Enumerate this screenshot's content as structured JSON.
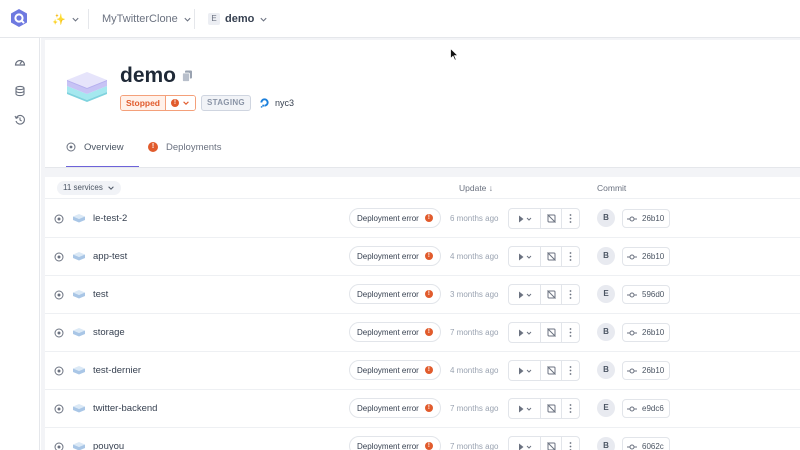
{
  "topbar": {
    "organization_icon": "sparkle-emoji",
    "project": "MyTwitterClone",
    "environment_badge": "E",
    "environment": "demo"
  },
  "sidebar": {
    "items": [
      {
        "icon": "gauge-icon"
      },
      {
        "icon": "database-icon"
      },
      {
        "icon": "history-icon"
      }
    ]
  },
  "header": {
    "title": "demo",
    "status": "Stopped",
    "mode": "STAGING",
    "region": "nyc3"
  },
  "tabs": [
    {
      "label": "Overview",
      "icon": "overview-icon",
      "active": true
    },
    {
      "label": "Deployments",
      "icon": "error-icon",
      "active": false
    }
  ],
  "table": {
    "services_count": "11 services",
    "columns": {
      "update": "Update",
      "commit": "Commit"
    },
    "rows": [
      {
        "name": "le-test-2",
        "status": "Deployment error",
        "updated": "6 months ago",
        "author": "B",
        "commit": "26b10"
      },
      {
        "name": "app-test",
        "status": "Deployment error",
        "updated": "4 months ago",
        "author": "B",
        "commit": "26b10"
      },
      {
        "name": "test",
        "status": "Deployment error",
        "updated": "3 months ago",
        "author": "E",
        "commit": "596d0"
      },
      {
        "name": "storage",
        "status": "Deployment error",
        "updated": "7 months ago",
        "author": "B",
        "commit": "26b10"
      },
      {
        "name": "test-dernier",
        "status": "Deployment error",
        "updated": "4 months ago",
        "author": "B",
        "commit": "26b10"
      },
      {
        "name": "twitter-backend",
        "status": "Deployment error",
        "updated": "7 months ago",
        "author": "E",
        "commit": "e9dc6"
      },
      {
        "name": "pouyou",
        "status": "Deployment error",
        "updated": "7 months ago",
        "author": "B",
        "commit": "6062c"
      }
    ]
  },
  "colors": {
    "accent": "#6d63d9",
    "error": "#e15b2c",
    "logo": "#6e79e0"
  }
}
